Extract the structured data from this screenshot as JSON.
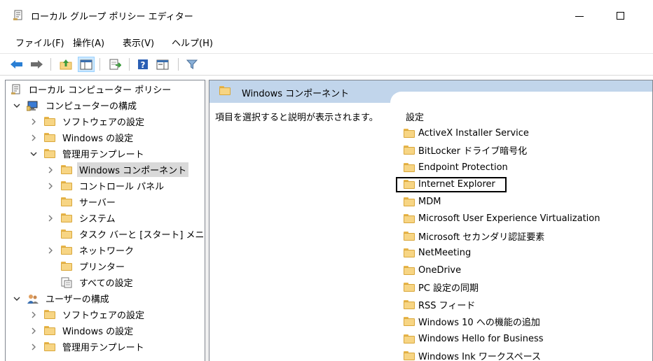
{
  "window": {
    "title": "ローカル グループ ポリシー エディター"
  },
  "menu": [
    "ファイル(F)",
    "操作(A)",
    "表示(V)",
    "ヘルプ(H)"
  ],
  "toolbar": {
    "buttons": [
      "back-arrow-icon",
      "forward-arrow-icon",
      "up-folder-icon",
      "show-hide-tree-icon",
      "export-list-icon",
      "help-icon",
      "extended-view-icon",
      "filter-icon"
    ]
  },
  "tree": [
    {
      "label": "ローカル コンピューター ポリシー",
      "depth": 0,
      "chevron": "none",
      "icon": "policy-icon"
    },
    {
      "label": "コンピューターの構成",
      "depth": 1,
      "chevron": "down",
      "icon": "computer-icon"
    },
    {
      "label": "ソフトウェアの設定",
      "depth": 2,
      "chevron": "right",
      "icon": "folder-icon"
    },
    {
      "label": "Windows の設定",
      "depth": 2,
      "chevron": "right",
      "icon": "folder-icon"
    },
    {
      "label": "管理用テンプレート",
      "depth": 2,
      "chevron": "down",
      "icon": "folder-icon"
    },
    {
      "label": "Windows コンポーネント",
      "depth": 3,
      "chevron": "right",
      "icon": "folder-icon",
      "selected": true
    },
    {
      "label": "コントロール パネル",
      "depth": 3,
      "chevron": "right",
      "icon": "folder-icon"
    },
    {
      "label": "サーバー",
      "depth": 3,
      "chevron": "none",
      "icon": "folder-icon"
    },
    {
      "label": "システム",
      "depth": 3,
      "chevron": "right",
      "icon": "folder-icon"
    },
    {
      "label": "タスク バーと [スタート] メニュー",
      "depth": 3,
      "chevron": "none",
      "icon": "folder-icon"
    },
    {
      "label": "ネットワーク",
      "depth": 3,
      "chevron": "right",
      "icon": "folder-icon"
    },
    {
      "label": "プリンター",
      "depth": 3,
      "chevron": "none",
      "icon": "folder-icon"
    },
    {
      "label": "すべての設定",
      "depth": 3,
      "chevron": "none",
      "icon": "all-settings-icon"
    },
    {
      "label": "ユーザーの構成",
      "depth": 1,
      "chevron": "down",
      "icon": "users-icon"
    },
    {
      "label": "ソフトウェアの設定",
      "depth": 2,
      "chevron": "right",
      "icon": "folder-icon"
    },
    {
      "label": "Windows の設定",
      "depth": 2,
      "chevron": "right",
      "icon": "folder-icon"
    },
    {
      "label": "管理用テンプレート",
      "depth": 2,
      "chevron": "right",
      "icon": "folder-icon"
    }
  ],
  "details": {
    "header_title": "Windows コンポーネント",
    "description": "項目を選択すると説明が表示されます。",
    "column_header": "設定",
    "items": [
      "ActiveX Installer Service",
      "BitLocker ドライブ暗号化",
      "Endpoint Protection",
      "Internet Explorer",
      "MDM",
      "Microsoft User Experience Virtualization",
      "Microsoft セカンダリ認証要素",
      "NetMeeting",
      "OneDrive",
      "PC 設定の同期",
      "RSS フィード",
      "Windows 10 への機能の追加",
      "Windows Hello for Business",
      "Windows Ink ワークスペース"
    ],
    "focused_index": 3
  },
  "colors": {
    "header_bg": "#c1d5eb",
    "selection_bg": "#d9d9d9",
    "folder": "#f7d584"
  }
}
